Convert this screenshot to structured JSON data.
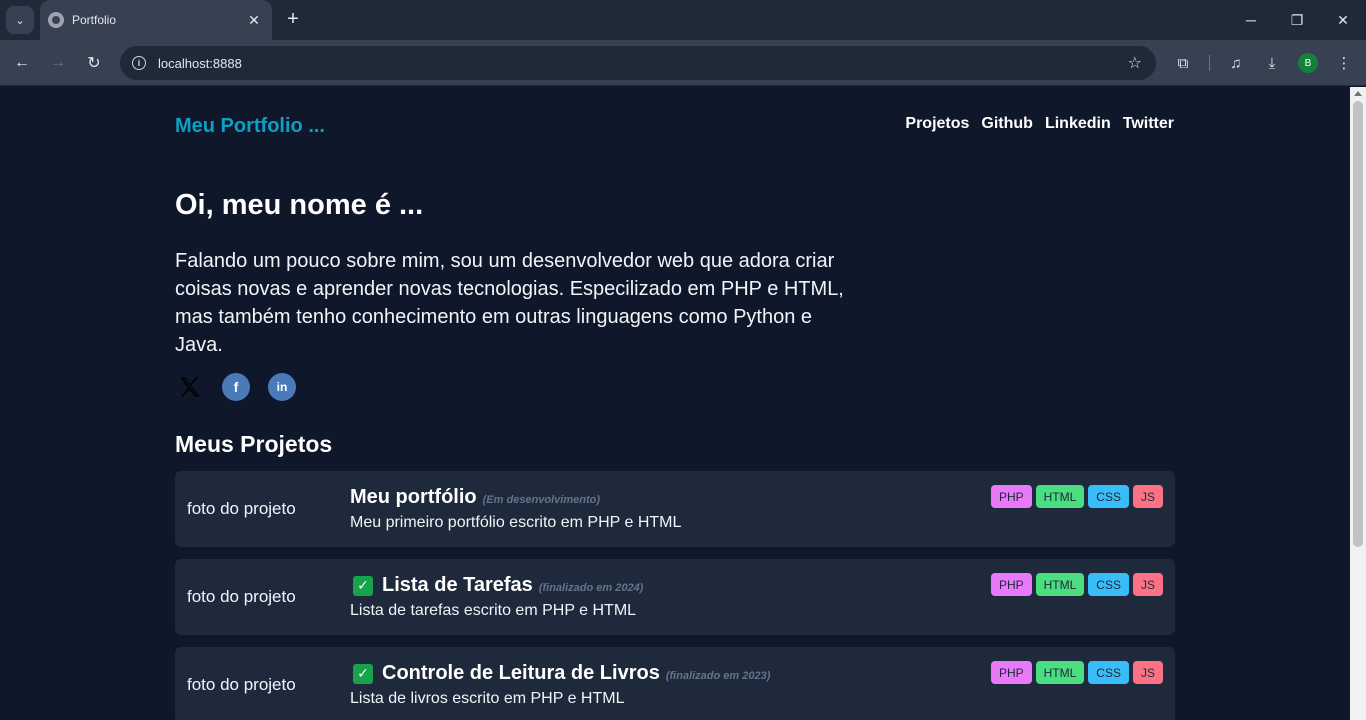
{
  "browser": {
    "tab_title": "Portfolio",
    "url": "localhost:8888",
    "profile_initial": "B"
  },
  "header": {
    "brand": "Meu Portfolio ...",
    "nav": [
      "Projetos",
      "Github",
      "Linkedin",
      "Twitter"
    ]
  },
  "hero": {
    "title": "Oi, meu nome é ...",
    "text": "Falando um pouco sobre mim, sou um desenvolvedor web que adora criar coisas novas e aprender novas tecnologias. Especilizado em PHP e HTML, mas também tenho conhecimento em outras linguagens como Python e Java."
  },
  "projects_section": {
    "title": "Meus Projetos",
    "items": [
      {
        "photo": "foto do projeto",
        "title": "Meu portfólio",
        "status": "(Em desenvolvimento)",
        "done": false,
        "desc": "Meu primeiro portfólio escrito em PHP e HTML",
        "tags": [
          "PHP",
          "HTML",
          "CSS",
          "JS"
        ]
      },
      {
        "photo": "foto do projeto",
        "title": "Lista de Tarefas",
        "status": "(finalizado em 2024)",
        "done": true,
        "desc": "Lista de tarefas escrito em PHP e HTML",
        "tags": [
          "PHP",
          "HTML",
          "CSS",
          "JS"
        ]
      },
      {
        "photo": "foto do projeto",
        "title": "Controle de Leitura de Livros",
        "status": "(finalizado em 2023)",
        "done": true,
        "desc": "Lista de livros escrito em PHP e HTML",
        "tags": [
          "PHP",
          "HTML",
          "CSS",
          "JS"
        ]
      }
    ]
  }
}
